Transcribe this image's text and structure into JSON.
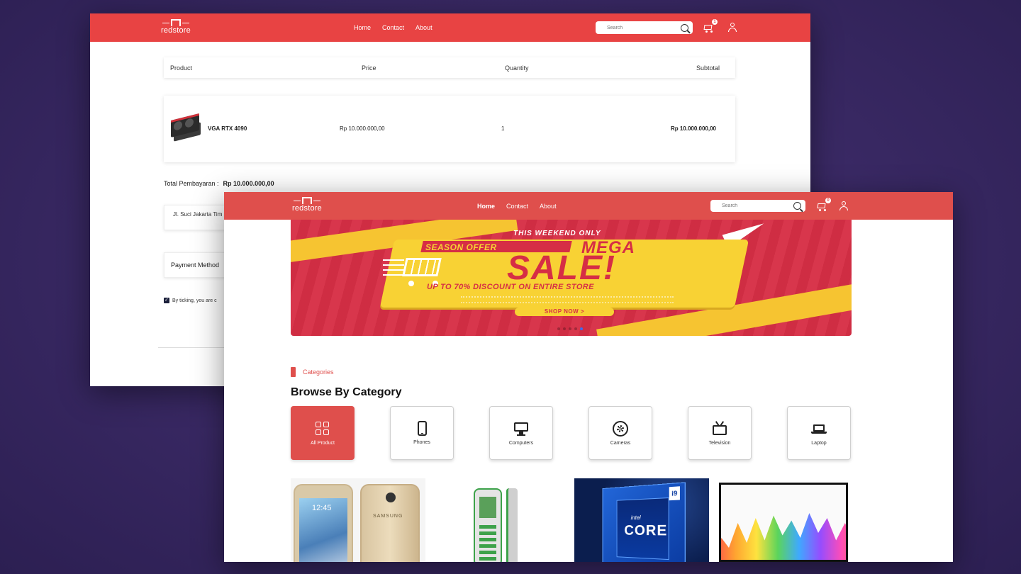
{
  "cart_window": {
    "nav": {
      "logo_text": "redstore",
      "links": [
        "Home",
        "Contact",
        "About"
      ],
      "search_placeholder": "Search",
      "cart_count": "1"
    },
    "table": {
      "headers": [
        "Product",
        "Price",
        "Quantity",
        "Subtotal"
      ],
      "rows": [
        {
          "product": "VGA RTX 4090",
          "price": "Rp 10.000.000,00",
          "quantity": "1",
          "subtotal": "Rp 10.000.000,00"
        }
      ]
    },
    "total_label": "Total Pembayaran :",
    "total_value": "Rp 10.000.000,00",
    "address": "Jl. Suci Jakarta Tim",
    "payment_label": "Payment Method",
    "terms_text": "By ticking, you are c"
  },
  "home_window": {
    "nav": {
      "logo_text": "redstore",
      "links": [
        "Home",
        "Contact",
        "About"
      ],
      "active_link": "Home",
      "search_placeholder": "Search",
      "cart_count": "0"
    },
    "banner": {
      "top_line": "THIS WEEKEND ONLY",
      "tag": "SEASON OFFER",
      "headline_1": "MEGA",
      "headline_2": "SALE!",
      "discount": "UP TO 70% DISCOUNT ON ENTIRE STORE",
      "cta": "SHOP NOW >",
      "active_slide": 4,
      "slide_count": 5
    },
    "categories": {
      "kicker": "Categories",
      "title": "Browse By Category",
      "items": [
        {
          "label": "All Product",
          "icon": "grid-icon",
          "active": true
        },
        {
          "label": "Phones",
          "icon": "phone-icon",
          "active": false
        },
        {
          "label": "Computers",
          "icon": "computer-icon",
          "active": false
        },
        {
          "label": "Cameras",
          "icon": "camera-icon",
          "active": false
        },
        {
          "label": "Television",
          "icon": "television-icon",
          "active": false
        },
        {
          "label": "Laptop",
          "icon": "laptop-icon",
          "active": false
        }
      ]
    },
    "product_previews": {
      "p1_clock": "12:45",
      "p1_brand": "SAMSUNG",
      "p3_brand": "intel",
      "p3_model": "CORE",
      "p3_tier": "i9"
    }
  },
  "colors": {
    "brand_red": "#e84343",
    "home_nav_red": "#df4f4c",
    "background": "#3b2a66",
    "banner_yellow": "#f8d234",
    "banner_red": "#d62e45"
  }
}
